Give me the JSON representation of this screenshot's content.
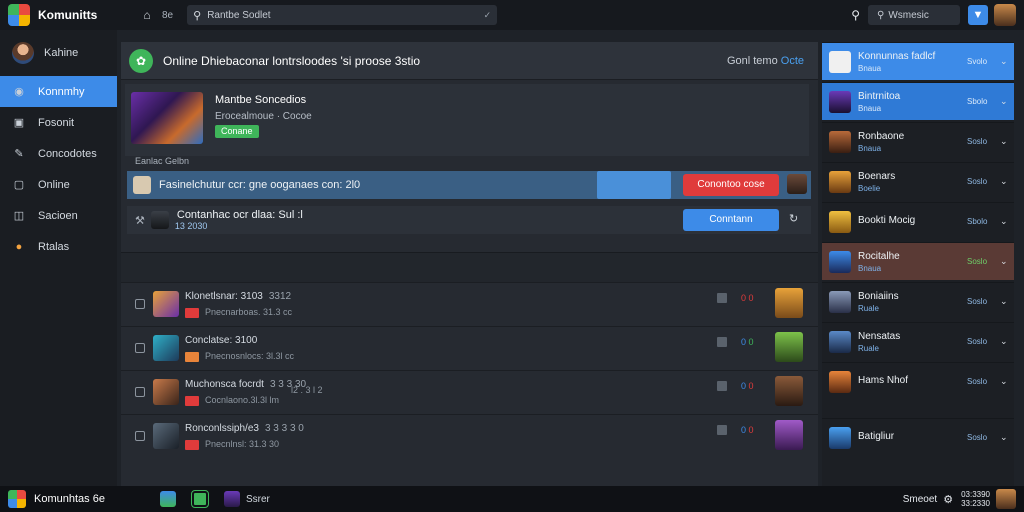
{
  "app": {
    "title": "Komunitts"
  },
  "topbar": {
    "tab_label": "8e",
    "search_text": "Rantbe Sodlet",
    "right_search_text": "Wsmesic",
    "colors": {
      "accent": "#3d8be8"
    }
  },
  "sidebar": {
    "profile_label": "Kahine",
    "items": [
      {
        "label": "Konnmhy",
        "icon": "chat-icon",
        "active": true
      },
      {
        "label": "Fosonit",
        "icon": "camera-icon"
      },
      {
        "label": "Concodotes",
        "icon": "edit-icon"
      },
      {
        "label": "Online",
        "icon": "monitor-icon"
      },
      {
        "label": "Sacioen",
        "icon": "gamepad-icon"
      },
      {
        "label": "Rtalas",
        "icon": "coin-icon"
      }
    ]
  },
  "main": {
    "header_title": "Online Dhiebaconar lontrsloodes 'si proose 3stio",
    "header_link": "Gonl temo",
    "header_link_accent": "Octe",
    "feature": {
      "title": "Mantbe Soncedios",
      "subtitle": "Erocealmoue · Cocoe",
      "badge": "Conane"
    },
    "section_label": "Eanlac Gelbn",
    "requests": [
      {
        "text": "Fasinelchutur ccr: gne ooganaes con: 2l0",
        "code": "",
        "button": "Conontoo cose",
        "button_color": "#e03b3b",
        "progress": 0.55
      },
      {
        "text": "Contanhac ocr dlaa: Sul :l",
        "code": "13 2030",
        "button": "Conntann",
        "button_color": "#3d8be8"
      }
    ],
    "list": [
      {
        "name": "Klonetlsnar: 3103",
        "score": "3312",
        "meta": "Pnecnarboas. 31.3 cc",
        "pair": [
          "0",
          "0"
        ],
        "pair_colors": [
          "#e03b3b",
          "#e03b3b"
        ]
      },
      {
        "name": "Conclatse: 3100",
        "score": "",
        "meta": "Pnecnosnlocs: 3l.3l cc",
        "pair": [
          "0",
          "0"
        ],
        "pair_colors": [
          "#3d8be8",
          "#3fb55a"
        ]
      },
      {
        "name": "Muchonsca focrdt",
        "score": "3 3 3 30",
        "meta": "l2 . 3 l 2",
        "meta2": "Cocnlaono.3l.3l lm",
        "pair": [
          "0",
          "0"
        ],
        "pair_colors": [
          "#3d8be8",
          "#e03b3b"
        ]
      },
      {
        "name": "Ronconlssiph/e3",
        "score": "3 3 3 3 0",
        "meta": "Pnecnlnsl: 31.3 30",
        "pair": [
          "0",
          "0"
        ],
        "pair_colors": [
          "#3d8be8",
          "#e03b3b"
        ]
      }
    ]
  },
  "right_panel": {
    "items": [
      {
        "name": "Konnunnas fadlcf",
        "sub": "Bnaua",
        "status": "Svolo",
        "style": "blue"
      },
      {
        "name": "Bintrnitoa",
        "sub": "Bnaua",
        "status": "Sbolo",
        "style": "blue2"
      },
      {
        "name": "Ronbaone",
        "sub": "Bnaua",
        "status": "Soslo",
        "style": ""
      },
      {
        "name": "Boenars",
        "sub": "Boelie",
        "status": "Soslo",
        "style": ""
      },
      {
        "name": "Bookti Mocig",
        "sub": "",
        "status": "Sbolo",
        "style": ""
      },
      {
        "name": "Rocitalhe",
        "sub": "Bnaua",
        "status": "Soslo",
        "style": "red"
      },
      {
        "name": "Boniaiins",
        "sub": "Ruale",
        "status": "Soslo",
        "style": ""
      },
      {
        "name": "Nensatas",
        "sub": "Ruale",
        "status": "Soslo",
        "style": ""
      },
      {
        "name": "Hams Nhof",
        "sub": "",
        "status": "Soslo",
        "style": ""
      },
      {
        "name": "Batigliur",
        "sub": "",
        "status": "Soslo",
        "style": ""
      }
    ]
  },
  "taskbar": {
    "app_name": "Komunhtas 6e",
    "app_label": "Ssrer",
    "tray_text": "Smeoet",
    "clock_line1": "03:3390",
    "clock_line2": "33:2330"
  }
}
